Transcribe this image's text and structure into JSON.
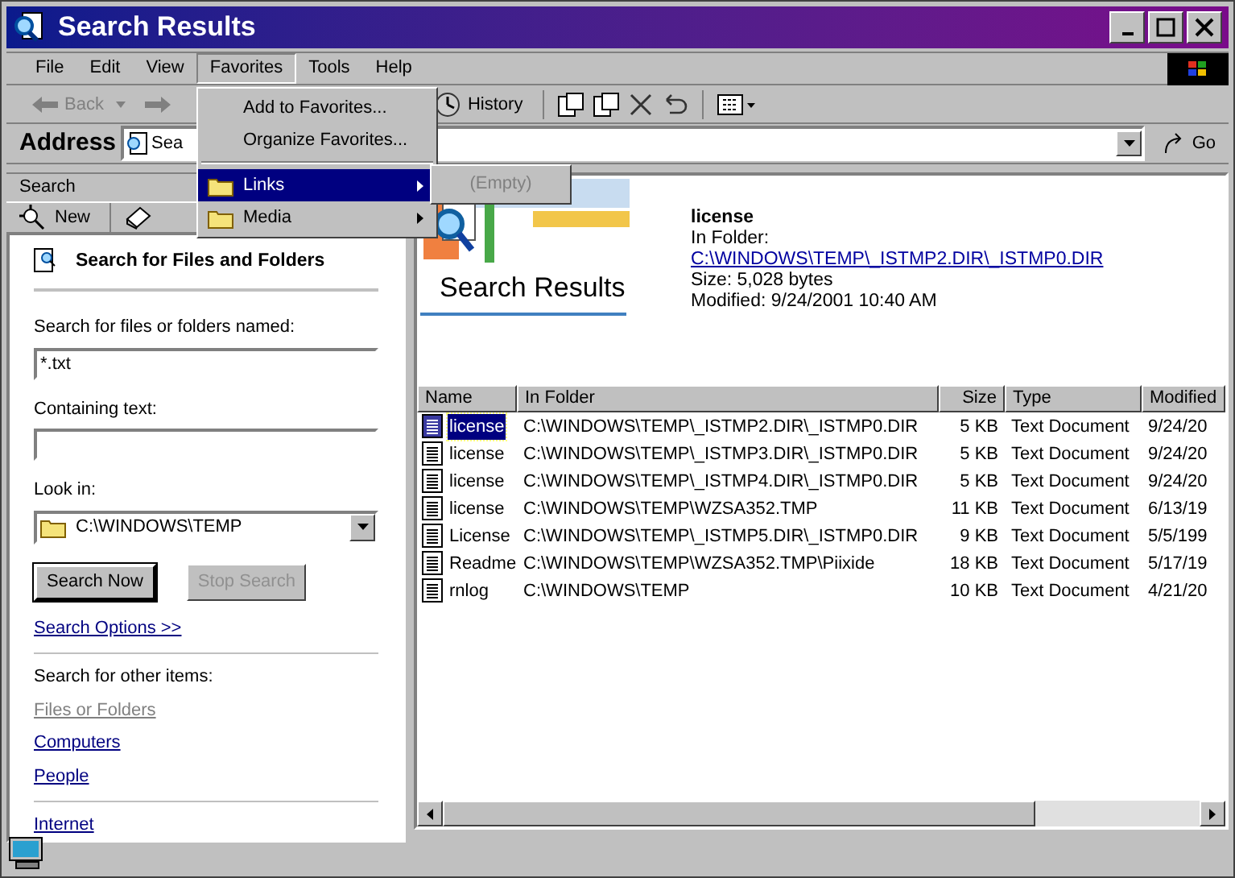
{
  "window": {
    "title": "Search Results"
  },
  "menu_bar": [
    {
      "label": "File",
      "selected": false
    },
    {
      "label": "Edit",
      "selected": false
    },
    {
      "label": "View",
      "selected": false
    },
    {
      "label": "Favorites",
      "selected": true
    },
    {
      "label": "Tools",
      "selected": false
    },
    {
      "label": "Help",
      "selected": false
    }
  ],
  "favorites_menu": [
    {
      "label": "Add to Favorites...",
      "kind": "item",
      "selected": false
    },
    {
      "label": "Organize Favorites...",
      "kind": "item",
      "selected": false
    },
    {
      "label": "Links",
      "kind": "folder",
      "selected": true
    },
    {
      "label": "Media",
      "kind": "folder",
      "selected": false
    }
  ],
  "links_submenu": [
    {
      "label": "(Empty)",
      "disabled": true
    }
  ],
  "toolbar": {
    "back": {
      "label": "Back",
      "disabled": true
    },
    "history": "History"
  },
  "address": {
    "label": "Address",
    "value": "Sea",
    "go": "Go"
  },
  "search_pane": {
    "title": "Search",
    "new": "New",
    "heading": "Search for Files and Folders",
    "named_label": "Search for files or folders named:",
    "named_value": "*.txt",
    "containing_label": "Containing text:",
    "look_in_label": "Look in:",
    "look_in_value": "C:\\WINDOWS\\TEMP",
    "search_now": {
      "label": "Search Now",
      "disabled": false
    },
    "stop_search": {
      "label": "Stop Search",
      "disabled": true
    },
    "options_link": "Search Options >>",
    "other_heading": "Search for other items:",
    "other_links": [
      {
        "label": "Files or Folders",
        "disabled": true
      },
      {
        "label": "Computers",
        "disabled": false
      },
      {
        "label": "People",
        "disabled": false
      }
    ],
    "internet_link": "Internet"
  },
  "results_header": {
    "title": "Search Results",
    "name": "license",
    "in_folder_label": "In Folder:",
    "path": "C:\\WINDOWS\\TEMP\\_ISTMP2.DIR\\_ISTMP0.DIR",
    "size": "Size: 5,028 bytes",
    "modified": "Modified: 9/24/2001 10:40 AM"
  },
  "table": {
    "columns": [
      "Name",
      "In Folder",
      "Size",
      "Type",
      "Modified"
    ],
    "rows": [
      {
        "name": "license",
        "folder": "C:\\WINDOWS\\TEMP\\_ISTMP2.DIR\\_ISTMP0.DIR",
        "size": "5 KB",
        "type": "Text Document",
        "modified": "9/24/20",
        "selected": true
      },
      {
        "name": "license",
        "folder": "C:\\WINDOWS\\TEMP\\_ISTMP3.DIR\\_ISTMP0.DIR",
        "size": "5 KB",
        "type": "Text Document",
        "modified": "9/24/20",
        "selected": false
      },
      {
        "name": "license",
        "folder": "C:\\WINDOWS\\TEMP\\_ISTMP4.DIR\\_ISTMP0.DIR",
        "size": "5 KB",
        "type": "Text Document",
        "modified": "9/24/20",
        "selected": false
      },
      {
        "name": "license",
        "folder": "C:\\WINDOWS\\TEMP\\WZSA352.TMP",
        "size": "11 KB",
        "type": "Text Document",
        "modified": "6/13/19",
        "selected": false
      },
      {
        "name": "License",
        "folder": "C:\\WINDOWS\\TEMP\\_ISTMP5.DIR\\_ISTMP0.DIR",
        "size": "9 KB",
        "type": "Text Document",
        "modified": "5/5/199",
        "selected": false
      },
      {
        "name": "Readme",
        "folder": "C:\\WINDOWS\\TEMP\\WZSA352.TMP\\Piixide",
        "size": "18 KB",
        "type": "Text Document",
        "modified": "5/17/19",
        "selected": false
      },
      {
        "name": "rnlog",
        "folder": "C:\\WINDOWS\\TEMP",
        "size": "10 KB",
        "type": "Text Document",
        "modified": "4/21/20",
        "selected": false
      }
    ]
  }
}
